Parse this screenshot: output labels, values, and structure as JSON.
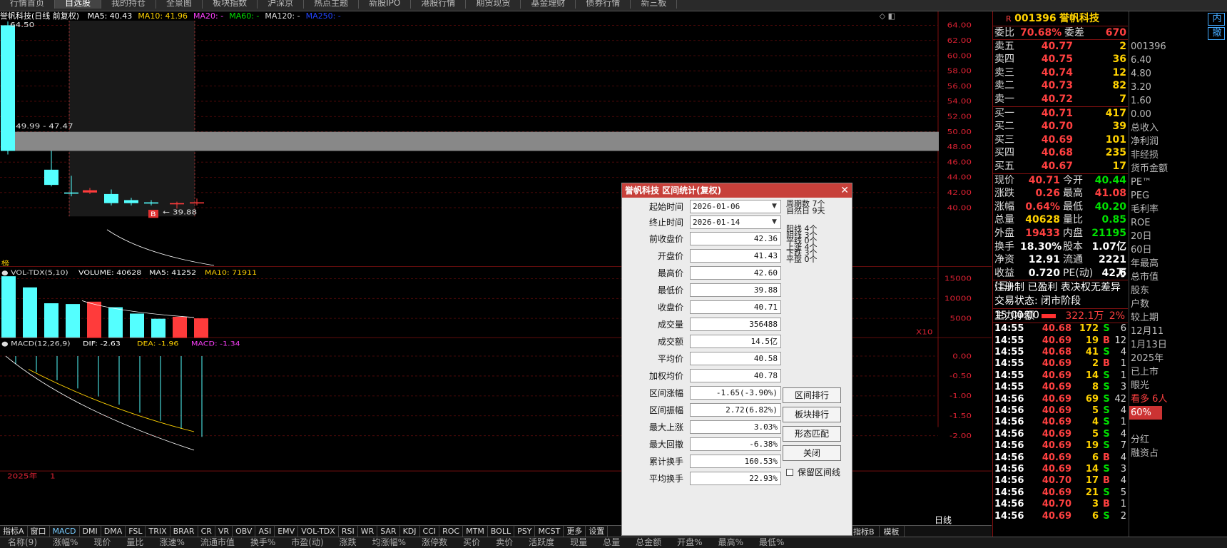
{
  "top_menu": [
    "行情首页",
    "自选股",
    "我的持仓",
    "全景图",
    "板块指数",
    "沪深京",
    "热点主题",
    "新股IPO",
    "港股行情",
    "期货现货",
    "基金理财",
    "债券行情",
    "新三板"
  ],
  "chart": {
    "title": "誉帆科技(日线 前复权)",
    "ma": [
      {
        "label": "MA5: 40.43",
        "color": "#ffffff"
      },
      {
        "label": "MA10: 41.96",
        "color": "#ffd200"
      },
      {
        "label": "MA20: -",
        "color": "#ff40ff"
      },
      {
        "label": "MA60: -",
        "color": "#00e000"
      },
      {
        "label": "MA120: -",
        "color": "#dddddd"
      },
      {
        "label": "MA250: -",
        "color": "#2244ff"
      }
    ],
    "price_axis": [
      "64.00",
      "62.00",
      "60.00",
      "58.00",
      "56.00",
      "54.00",
      "52.00",
      "50.00",
      "48.00",
      "46.00",
      "44.00",
      "42.00",
      "40.00"
    ],
    "high_label": "64.50",
    "range_label": "49.99 - 47.47",
    "low_label": "39.88",
    "marker_b": "B",
    "marker_top": "榜",
    "vol_title": "VOL-TDX(5,10)",
    "vol_values": [
      {
        "label": "VOLUME: 40628",
        "color": "#ffffff"
      },
      {
        "label": "MA5: 41252",
        "color": "#ffffff"
      },
      {
        "label": "MA10: 71911",
        "color": "#ffd200"
      }
    ],
    "vol_axis": [
      "15000",
      "10000",
      "5000"
    ],
    "vol_unit": "X10",
    "macd_title": "MACD(12,26,9)",
    "macd_values": [
      {
        "label": "DIF: -2.63",
        "color": "#ffffff"
      },
      {
        "label": "DEA: -1.96",
        "color": "#ffd200"
      },
      {
        "label": "MACD: -1.34",
        "color": "#ff40ff"
      }
    ],
    "macd_axis": [
      "0.00",
      "-0.50",
      "-1.00",
      "-1.50",
      "-2.00"
    ],
    "year_label": "2025年",
    "year_mark": "1"
  },
  "chart_data": {
    "type": "candlestick",
    "title": "誉帆科技(日线 前复权)",
    "ylim": [
      39,
      65
    ],
    "candles": [
      {
        "open": 47.47,
        "close": 64.0,
        "high": 64.5,
        "low": 47.0,
        "color": "cyan"
      },
      {
        "open": 47.47,
        "close": 49.99,
        "high": 49.99,
        "low": 47.47,
        "color": "gray"
      },
      {
        "open": 45.0,
        "close": 43.0,
        "high": 47.5,
        "low": 42.8,
        "color": "cyan"
      },
      {
        "open": 42.0,
        "close": 42.0,
        "high": 44.2,
        "low": 41.5,
        "color": "cyan"
      },
      {
        "open": 42.3,
        "close": 42.0,
        "high": 42.6,
        "low": 41.8,
        "color": "red"
      },
      {
        "open": 41.8,
        "close": 40.6,
        "high": 42.4,
        "low": 40.3,
        "color": "cyan"
      },
      {
        "open": 41.0,
        "close": 40.6,
        "high": 41.3,
        "low": 40.3,
        "color": "cyan"
      },
      {
        "open": 40.7,
        "close": 40.6,
        "high": 41.0,
        "low": 40.3,
        "color": "cyan"
      },
      {
        "open": 40.5,
        "close": 40.6,
        "high": 40.8,
        "low": 39.88,
        "color": "red"
      },
      {
        "open": 40.6,
        "close": 40.71,
        "high": 41.2,
        "low": 40.3,
        "color": "red"
      }
    ],
    "volume": [
      15600,
      12800,
      8800,
      8600,
      9200,
      7800,
      6200,
      4900,
      5400,
      5000
    ],
    "macd": {
      "dif_start": -0.2,
      "dif_end": -2.63,
      "dea_end": -1.96
    }
  },
  "right_panel": {
    "code": "001396",
    "name": "誉帆科技",
    "r_mark": "R",
    "weibi_label": "委比",
    "weibi": "70.68%",
    "weicha_label": "委差",
    "weicha": "670",
    "asks": [
      {
        "l": "卖五",
        "p": "40.77",
        "v": "2"
      },
      {
        "l": "卖四",
        "p": "40.75",
        "v": "36"
      },
      {
        "l": "卖三",
        "p": "40.74",
        "v": "12"
      },
      {
        "l": "卖二",
        "p": "40.73",
        "v": "82"
      },
      {
        "l": "卖一",
        "p": "40.72",
        "v": "7"
      }
    ],
    "bids": [
      {
        "l": "买一",
        "p": "40.71",
        "v": "417"
      },
      {
        "l": "买二",
        "p": "40.70",
        "v": "39"
      },
      {
        "l": "买三",
        "p": "40.69",
        "v": "101"
      },
      {
        "l": "买四",
        "p": "40.68",
        "v": "235"
      },
      {
        "l": "买五",
        "p": "40.67",
        "v": "17"
      }
    ],
    "stats": [
      {
        "l1": "现价",
        "v1": "40.71",
        "l2": "今开",
        "v2": "40.44",
        "c1": "#ff4040",
        "c2": "#00e000"
      },
      {
        "l1": "涨跌",
        "v1": "0.26",
        "l2": "最高",
        "v2": "41.08",
        "c1": "#ff4040",
        "c2": "#ff4040"
      },
      {
        "l1": "涨幅",
        "v1": "0.64%",
        "l2": "最低",
        "v2": "40.20",
        "c1": "#ff4040",
        "c2": "#00e000"
      },
      {
        "l1": "总量",
        "v1": "40628",
        "l2": "量比",
        "v2": "0.85",
        "c1": "#ffd200",
        "c2": "#00e000"
      },
      {
        "l1": "外盘",
        "v1": "19433",
        "l2": "内盘",
        "v2": "21195",
        "c1": "#ff4040",
        "c2": "#00e000"
      },
      {
        "l1": "换手",
        "v1": "18.30%",
        "l2": "股本",
        "v2": "1.07亿",
        "c1": "#ffffff",
        "c2": "#ffffff"
      },
      {
        "l1": "净资",
        "v1": "12.91",
        "l2": "流通",
        "v2": "2221万",
        "c1": "#ffffff",
        "c2": "#ffffff"
      },
      {
        "l1": "收益(三)",
        "v1": "0.720",
        "l2": "PE(动)",
        "v2": "42.6",
        "c1": "#ffffff",
        "c2": "#ffffff"
      }
    ],
    "reg_line": "注册制 已盈利 表决权无差异",
    "status_label": "交易状态: 闭市阶段",
    "status_time": "15:00:00",
    "main_flow_label": "主力净额",
    "main_flow": "322.1万",
    "main_flow_pct": "2%",
    "ticks": [
      {
        "t": "14:55",
        "p": "40.68",
        "v": "172",
        "s": "S",
        "n": "6"
      },
      {
        "t": "14:55",
        "p": "40.69",
        "v": "19",
        "s": "B",
        "n": "12"
      },
      {
        "t": "14:55",
        "p": "40.68",
        "v": "41",
        "s": "S",
        "n": "4"
      },
      {
        "t": "14:55",
        "p": "40.69",
        "v": "2",
        "s": "B",
        "n": "1"
      },
      {
        "t": "14:55",
        "p": "40.69",
        "v": "14",
        "s": "S",
        "n": "1"
      },
      {
        "t": "14:55",
        "p": "40.69",
        "v": "8",
        "s": "S",
        "n": "3"
      },
      {
        "t": "14:56",
        "p": "40.69",
        "v": "69",
        "s": "S",
        "n": "42"
      },
      {
        "t": "14:56",
        "p": "40.69",
        "v": "5",
        "s": "S",
        "n": "4"
      },
      {
        "t": "14:56",
        "p": "40.69",
        "v": "4",
        "s": "S",
        "n": "1"
      },
      {
        "t": "14:56",
        "p": "40.69",
        "v": "5",
        "s": "S",
        "n": "4"
      },
      {
        "t": "14:56",
        "p": "40.69",
        "v": "19",
        "s": "S",
        "n": "7"
      },
      {
        "t": "14:56",
        "p": "40.69",
        "v": "6",
        "s": "B",
        "n": "4"
      },
      {
        "t": "14:56",
        "p": "40.69",
        "v": "14",
        "s": "S",
        "n": "3"
      },
      {
        "t": "14:56",
        "p": "40.70",
        "v": "17",
        "s": "B",
        "n": "4"
      },
      {
        "t": "14:56",
        "p": "40.69",
        "v": "21",
        "s": "S",
        "n": "5"
      },
      {
        "t": "14:56",
        "p": "40.70",
        "v": "3",
        "s": "B",
        "n": "1"
      },
      {
        "t": "14:56",
        "p": "40.69",
        "v": "6",
        "s": "S",
        "n": "2"
      }
    ]
  },
  "edge_panel": [
    "内",
    "撤",
    "001396",
    "6.40",
    "4.80",
    "3.20",
    "1.60",
    "0.00",
    "总收入",
    "净利润",
    "非经损",
    "货币金额",
    "PE™",
    "PEG",
    "毛利率",
    "ROE",
    "20日",
    "60日",
    "年最高",
    "总市值",
    "股东",
    "户数",
    "较上期",
    "12月11",
    "1月13日",
    "2025年",
    "已上市",
    "眼光",
    "看多 6人",
    "60%",
    "",
    "分红",
    "融资占"
  ],
  "dialog": {
    "title": "誉帆科技 区间统计(复权)",
    "start_label": "起始时间",
    "start": "2026-01-06",
    "end_label": "终止时间",
    "end": "2026-01-14",
    "period_label": "周期数",
    "period": "7个",
    "natural_label": "自然日",
    "natural": "9天",
    "counts": [
      "阳线 4个",
      "阴线 3个",
      "平线 0个",
      "上涨 4个",
      "下跌 3个",
      "平盘 0个"
    ],
    "fields": [
      {
        "l": "前收盘价",
        "v": "42.36"
      },
      {
        "l": "开盘价",
        "v": "41.43"
      },
      {
        "l": "最高价",
        "v": "42.60"
      },
      {
        "l": "最低价",
        "v": "39.88"
      },
      {
        "l": "收盘价",
        "v": "40.71"
      },
      {
        "l": "成交量",
        "v": "356488"
      },
      {
        "l": "成交额",
        "v": "14.5亿"
      },
      {
        "l": "平均价",
        "v": "40.58"
      },
      {
        "l": "加权均价",
        "v": "40.78"
      },
      {
        "l": "区间涨幅",
        "v": "-1.65(-3.90%)"
      },
      {
        "l": "区间振幅",
        "v": "2.72(6.82%)"
      },
      {
        "l": "最大上涨",
        "v": "3.03%"
      },
      {
        "l": "最大回撤",
        "v": "-6.38%"
      },
      {
        "l": "累计换手",
        "v": "160.53%"
      },
      {
        "l": "平均换手",
        "v": "22.93%"
      }
    ],
    "buttons": [
      "区间排行",
      "板块排行",
      "形态匹配",
      "关闭"
    ],
    "keep_label": "保留区间线"
  },
  "tabs": [
    "指标A",
    "窗口",
    "MACD",
    "DMI",
    "DMA",
    "FSL",
    "TRIX",
    "BRAR",
    "CR",
    "VR",
    "OBV",
    "ASI",
    "EMV",
    "VOL-TDX",
    "RSI",
    "WR",
    "SAR",
    "KDJ",
    "CCI",
    "ROC",
    "MTM",
    "BOLL",
    "PSY",
    "MCST",
    "更多",
    "设置"
  ],
  "tabs_right": [
    "指标B",
    "模板"
  ],
  "tab_daily": "日线",
  "bottom_cols": [
    "名称(9)",
    "涨幅%",
    "现价",
    "量比",
    "涨速%",
    "流通市值",
    "换手%",
    "市盈(动)",
    "涨跌",
    "均涨幅%",
    "涨停数",
    "买价",
    "卖价",
    "活跃度",
    "现量",
    "总量",
    "总金额",
    "开盘%",
    "最高%",
    "最低%"
  ]
}
